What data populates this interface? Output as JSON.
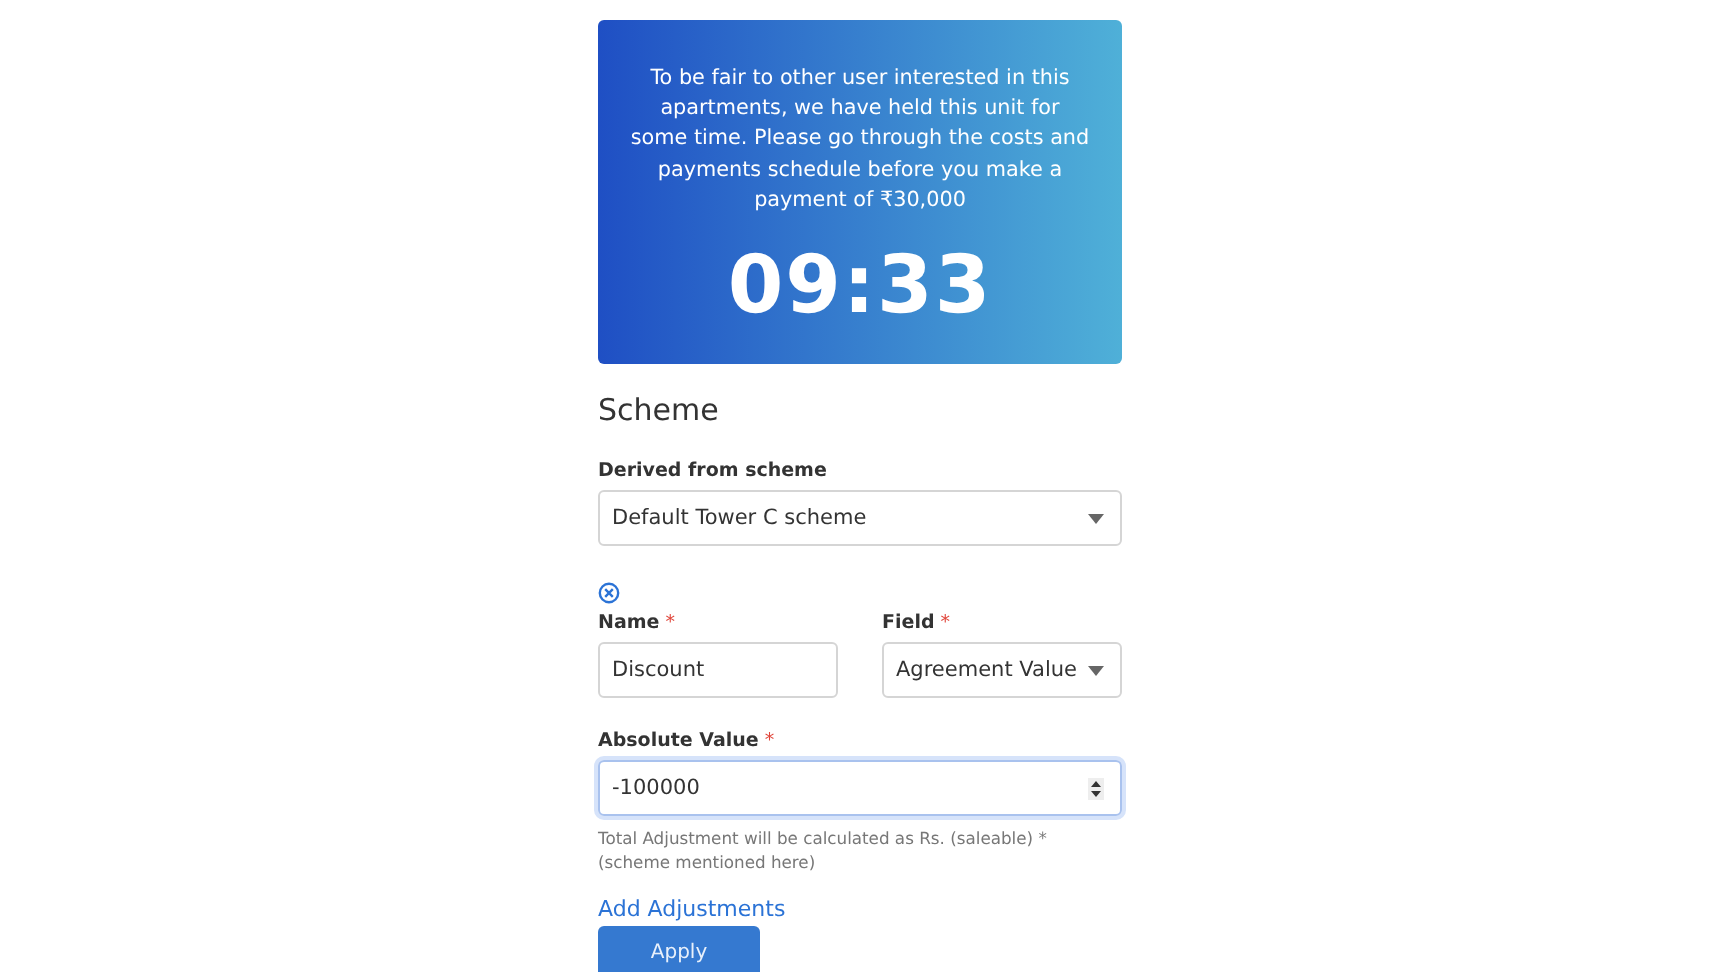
{
  "banner": {
    "message": "To be fair to other user interested in this apartments, we have held this unit for some time. Please go through the costs and payments schedule before you make a payment of ₹30,000",
    "timer": "09:33"
  },
  "section_title": "Scheme",
  "derived": {
    "label": "Derived from scheme",
    "value": "Default Tower C scheme"
  },
  "adjustment": {
    "name": {
      "label": "Name",
      "mark": "*",
      "value": "Discount"
    },
    "field": {
      "label": "Field",
      "mark": "*",
      "value": "Agreement Value"
    },
    "absolute": {
      "label": "Absolute Value",
      "mark": "*",
      "value": "-100000",
      "focused": true
    },
    "hint": "Total Adjustment will be calculated as Rs. (saleable) * (scheme mentioned here)"
  },
  "add_link": "Add Adjustments",
  "apply_button": "Apply"
}
